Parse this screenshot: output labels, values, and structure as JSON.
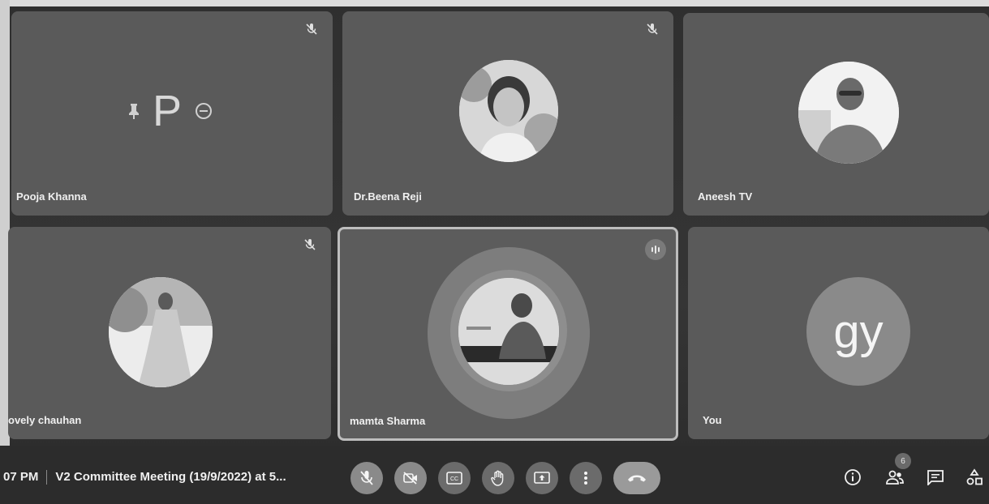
{
  "participants": [
    {
      "name": "Pooja Khanna",
      "avatar_letter": "P"
    },
    {
      "name": "Dr.Beena Reji"
    },
    {
      "name": "Aneesh TV"
    },
    {
      "name": "ovely chauhan"
    },
    {
      "name": "mamta Sharma"
    },
    {
      "name": "You",
      "avatar_letter": "gy"
    }
  ],
  "footer": {
    "time": "07 PM",
    "meeting_title": "V2 Committee Meeting (19/9/2022) at 5..."
  },
  "people_count": "6",
  "icons": {
    "mic_off": "mic-off-icon",
    "camera_off": "camera-off-icon",
    "captions": "captions-icon",
    "raise_hand": "raise-hand-icon",
    "present": "present-screen-icon",
    "more": "more-options-icon",
    "end_call": "end-call-icon",
    "info": "info-icon",
    "people": "people-icon",
    "chat": "chat-icon",
    "activities": "activities-icon"
  },
  "colors": {
    "tile": "#5a5a5a",
    "bar": "#2c2c2c",
    "control": "#6b6b6b"
  }
}
